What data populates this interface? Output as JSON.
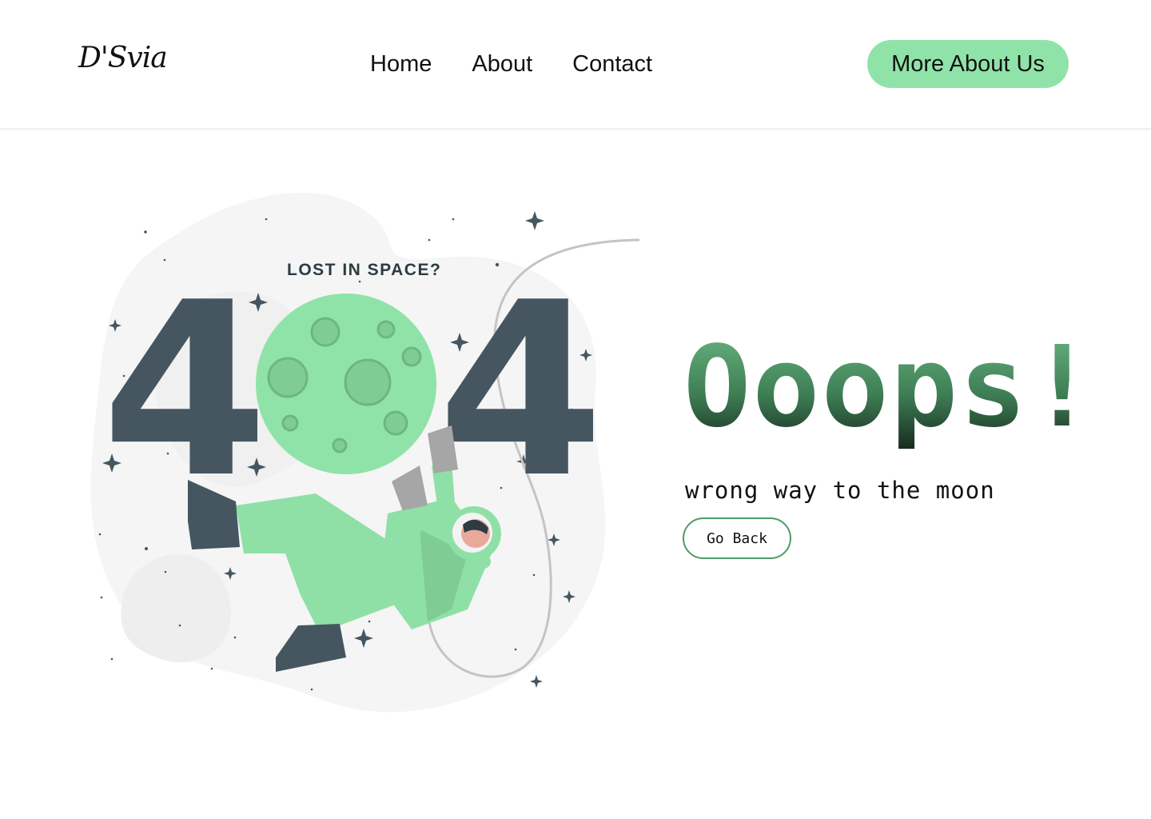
{
  "header": {
    "logo": "D'Svia",
    "nav": [
      {
        "label": "Home"
      },
      {
        "label": "About"
      },
      {
        "label": "Contact"
      }
    ],
    "cta_label": "More About Us"
  },
  "illustration": {
    "caption": "LOST IN SPACE?",
    "digits": [
      "4",
      "4"
    ],
    "colors": {
      "digit": "#455660",
      "moon": "#90e3a8",
      "suit": "#8fe0a6",
      "boot": "#455660",
      "glove": "#a6a6a6",
      "blob": "#f5f5f5"
    }
  },
  "main": {
    "heading": "Ooops!",
    "tagline": "wrong way to the moon",
    "back_label": "Go Back"
  },
  "colors": {
    "accent": "#90e3a8",
    "button_border": "#4f9a66"
  }
}
